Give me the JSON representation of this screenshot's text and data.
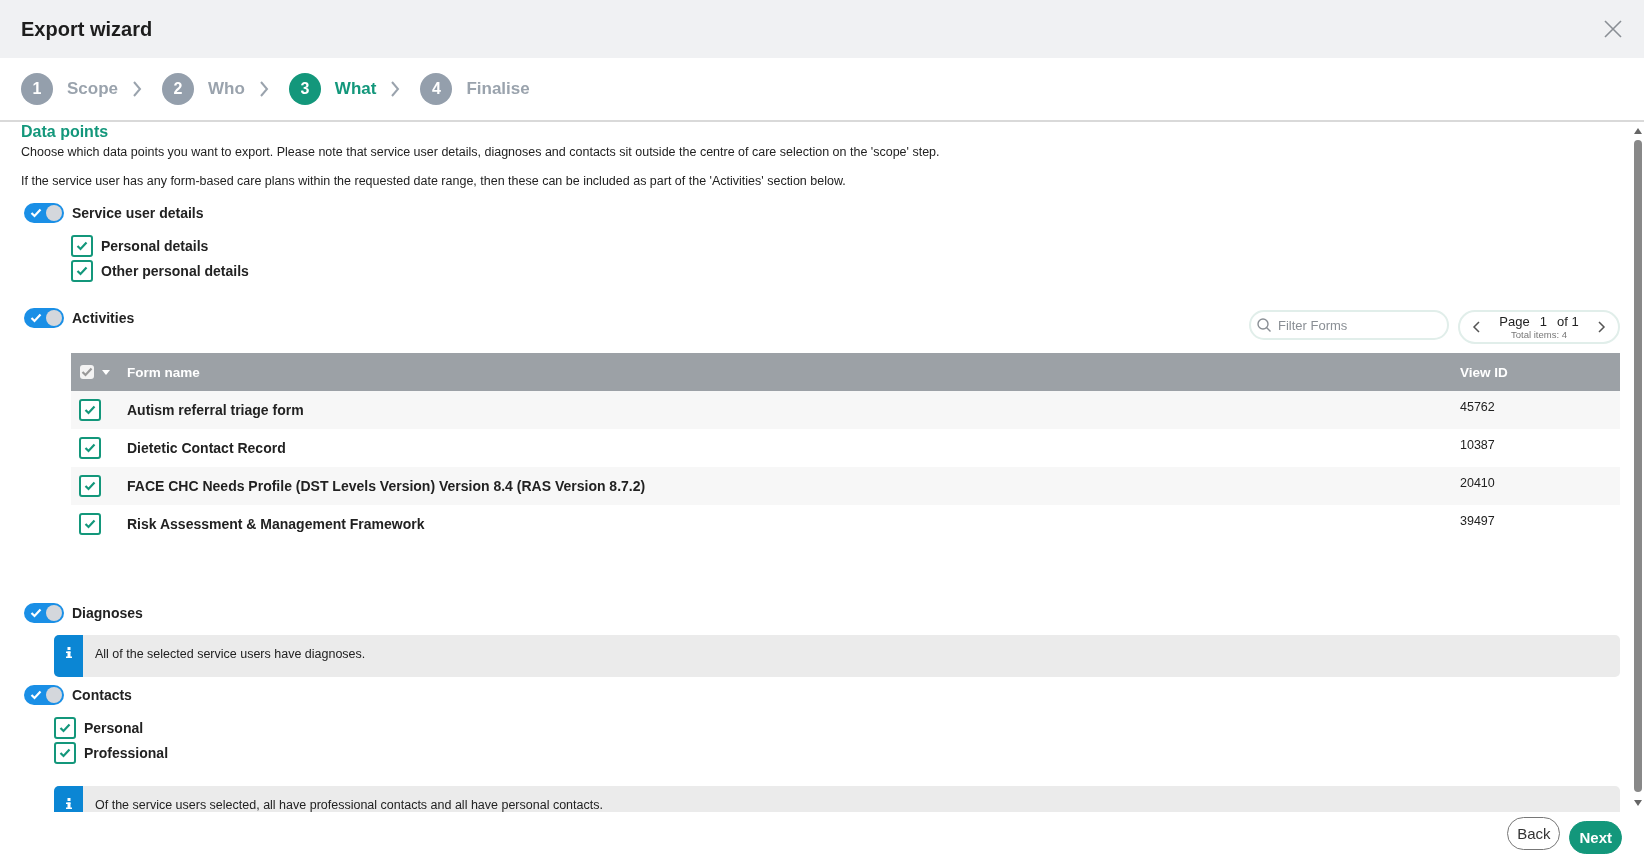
{
  "window": {
    "title": "Export wizard"
  },
  "steps": [
    {
      "number": "1",
      "label": "Scope",
      "selected": false
    },
    {
      "number": "2",
      "label": "Who",
      "selected": false
    },
    {
      "number": "3",
      "label": "What",
      "selected": true
    },
    {
      "number": "4",
      "label": "Finalise",
      "selected": false
    }
  ],
  "heading": "Data points",
  "intro": [
    "Choose which data points you want to export. Please note that service user details, diagnoses and contacts sit outside the centre of care selection on the 'scope' step.",
    "If the service user has any form-based care plans within the requested date range, then these can be included as part of the 'Activities' section below."
  ],
  "sections": [
    {
      "kind": "checklist",
      "label": "Service user details",
      "on": true,
      "options": [
        {
          "label": "Personal details",
          "checked": true
        },
        {
          "label": "Other personal details",
          "checked": true
        }
      ]
    },
    {
      "kind": "forms",
      "label": "Activities",
      "on": true,
      "filter": {
        "placeholder": "Filter Forms"
      },
      "pager": {
        "label": "Page",
        "page": "1",
        "of": "of 1",
        "total": "Total items: 4"
      },
      "table": {
        "select_all": true,
        "columns": [
          "Form name",
          "View ID"
        ],
        "rows": [
          {
            "checked": true,
            "name": "Autism referral triage form",
            "view_id": "45762"
          },
          {
            "checked": true,
            "name": "Dietetic Contact Record",
            "view_id": "10387"
          },
          {
            "checked": true,
            "name": "FACE CHC Needs Profile (DST Levels Version) Version 8.4 (RAS Version 8.7.2)",
            "view_id": "20410"
          },
          {
            "checked": true,
            "name": "Risk Assessment & Management Framework",
            "view_id": "39497"
          }
        ]
      }
    },
    {
      "kind": "notice",
      "label": "Diagnoses",
      "on": true,
      "note": "All of the selected service users have diagnoses."
    },
    {
      "kind": "contacts",
      "label": "Contacts",
      "on": true,
      "options": [
        {
          "label": "Personal",
          "checked": true
        },
        {
          "label": "Professional",
          "checked": true
        }
      ],
      "note": "Of the service users selected, all have professional contacts and all have personal contacts."
    }
  ],
  "buttons": [
    {
      "label": "Back",
      "kind": "secondary"
    },
    {
      "label": "Next",
      "kind": "primary"
    }
  ]
}
